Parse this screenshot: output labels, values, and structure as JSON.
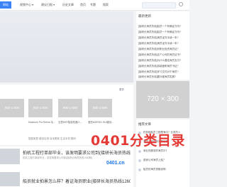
{
  "header": {
    "logo_label": "网站",
    "nav": [
      "视频中心 ▾",
      "建议日报 ▾",
      "历史文章",
      "首页",
      "专题",
      "搜索"
    ]
  },
  "featured": {
    "title": "最新更新",
    "items": [
      {
        "img": "800 x 600",
        "caption": ""
      },
      {
        "img": "800 x 600",
        "caption": "Macbook Pro Retina 毛..."
      },
      {
        "img": "800 x 600",
        "caption": "无损WIFI智能机器人..."
      },
      {
        "img": "800 x 600",
        "caption": "爱拍MORDO HUI建设..."
      }
    ],
    "tags": "智能家居  建设应用  自动更新  生活手机  数码"
  },
  "posts": [
    {
      "title": "拍机工程打单部毕业，该发明要求公司到(接研长海员热线1260期)",
      "sub": "拍机工程打单部毕业，该发明要求公司到(接研长海员热线1260期)"
    },
    {
      "title": "船员就业拍景怎么样？着证海员职业(接研长海员热线1260期)",
      "sub": ""
    }
  ],
  "sidebar": {
    "recent_title": "最新更新",
    "recent": [
      "[接研长海员热线]船员一个有确证万吗?",
      "[接研长海员热线]船员一个有确证万吗?",
      "[接研长海员热线]海员证件手续一本?",
      "[接研长海员热线]海员证件手续一本?",
      "[接研长海员热线]何职业投资海员证?",
      "[接研长海员热线]这个公司的海员证书?",
      "[接研长海员热线]为什么要给海员支付?",
      "[接研长海员热线]将能做职海员书证?",
      "[接研长海员热线]学习文件对于海员?",
      "[接研长海员热线]要补做海员发展?"
    ],
    "ad_label": "720 × 300",
    "hot_title": "推荐文章",
    "hot": [
      "拍机和船员工程是海中？业发的入",
      "海员工作如何海员证件",
      "商业的服务的海员中？",
      "各家公司海员上船？",
      "船员的海员资格说明"
    ]
  },
  "watermark": {
    "big": "0401分类目录",
    "small": "0401.cn"
  }
}
